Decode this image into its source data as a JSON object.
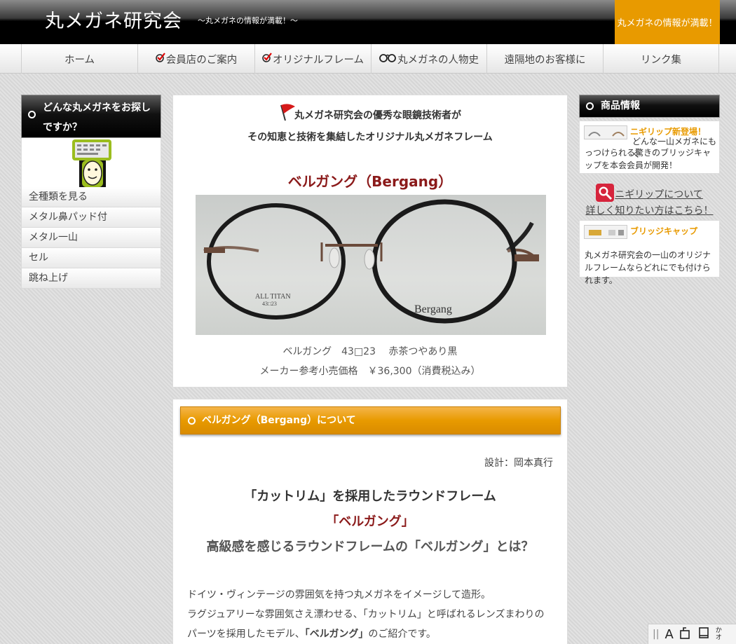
{
  "header": {
    "title": "丸メガネ研究会",
    "tagline": "～丸メガネの情報が満載！～",
    "badge": "丸メガネの情報が満載！"
  },
  "nav": [
    {
      "label": "ホーム",
      "icon": ""
    },
    {
      "label": "会員店のご案内",
      "icon": "check-icon"
    },
    {
      "label": "オリジナルフレーム",
      "icon": "check-icon"
    },
    {
      "label": "丸メガネの人物史",
      "icon": "glasses-icon"
    },
    {
      "label": "遠隔地のお客様に",
      "icon": ""
    },
    {
      "label": "リンク集",
      "icon": ""
    }
  ],
  "left_sidebar": {
    "heading": "どんな丸メガネをお探しですか？",
    "items": [
      "全種類を見る",
      "メタル鼻パッド付",
      "メタル一山",
      "セル",
      "跳ね上げ"
    ]
  },
  "main": {
    "intro_line1": "丸メガネ研究会の優秀な眼鏡技術者が",
    "intro_line2": "その知恵と技術を集結したオリジナル丸メガネフレーム",
    "product_name": "ベルガング（Bergang）",
    "photo_labels": {
      "temple_print": "ALL TITAN",
      "size_print": "43□23",
      "lens_print": "Bergang"
    },
    "caption_line1": "ベルガング　43□23　 赤茶つやあり黒",
    "caption_line2": "メーカー参考小売価格　￥36,300（消費税込み）"
  },
  "about": {
    "bar_title": "ベルガング（Bergang）について",
    "designer": "設計：岡本真行",
    "heading_line1": "「カットリム」を採用したラウンドフレーム",
    "heading_line2": "「ベルガング」",
    "heading_line3": "高級感を感じるラウンドフレームの「ベルガング」とは？",
    "body_line1": "ドイツ・ヴィンテージの雰囲気を持つ丸メガネをイメージして造形。",
    "body_line2": "ラグジュアリーな雰囲気さえ漂わせる、「カットリム」と呼ばれるレンズまわりの",
    "body_line3_pre": "パーツを採用したモデル、",
    "body_line3_bold": "「ベルガング」",
    "body_line3_post": "のご紹介です。"
  },
  "right_sidebar": {
    "heading": "商品情報",
    "card1_title": "ニギリップ新登場！",
    "card1_text_line1": "どんな一山メガネにもく",
    "card1_text_rest": "っつけられる驚きのブリッジキャップを本会会員が開発！",
    "link1": "ニギリップについて",
    "link2": "詳しく知りたい方はこちら！",
    "card2_title": "ブリッジキャップ",
    "card2_text": "丸メガネ研究会の一山のオリジナルフレームならどれにでも付けられます。"
  },
  "toolbar": {
    "font_icon_label": "A",
    "side_text": "か オ"
  },
  "colors": {
    "accent_orange": "#e89a00",
    "product_red": "#8b1a1a",
    "header_black": "#000000"
  }
}
